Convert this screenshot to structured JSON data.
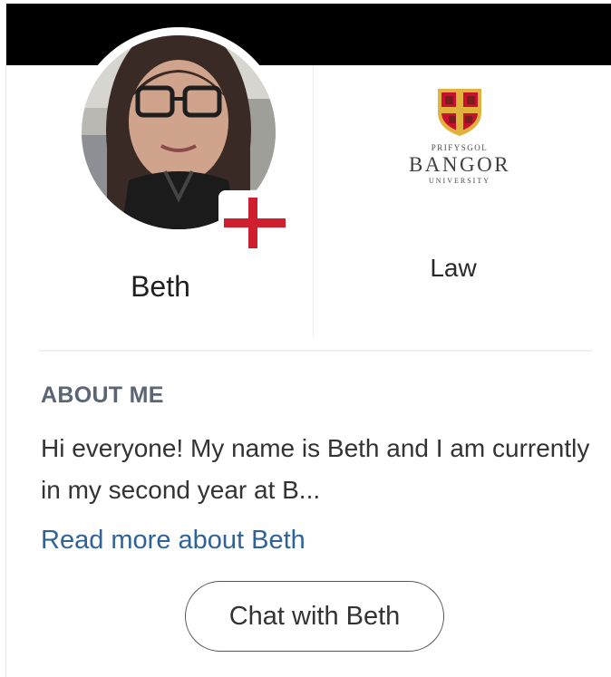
{
  "profile": {
    "name": "Beth",
    "flag_icon": "england-flag-icon",
    "avatar_icon": "profile-photo",
    "subject": "Law"
  },
  "university": {
    "logo_line1": "PRIFYSGOL",
    "logo_line2": "BANGOR",
    "logo_line3": "UNIVERSITY"
  },
  "about": {
    "heading": "ABOUT ME",
    "text": "Hi everyone! My name is Beth and I am currently in my second year at B...",
    "read_more": "Read more about Beth"
  },
  "actions": {
    "chat_label": "Chat with Beth"
  },
  "colors": {
    "header_bar": "#000000",
    "heading": "#5b6573",
    "link": "#2f6398",
    "flag_red": "#cf1f2e",
    "logo_red": "#c8102e",
    "logo_gold": "#e2b33c"
  }
}
